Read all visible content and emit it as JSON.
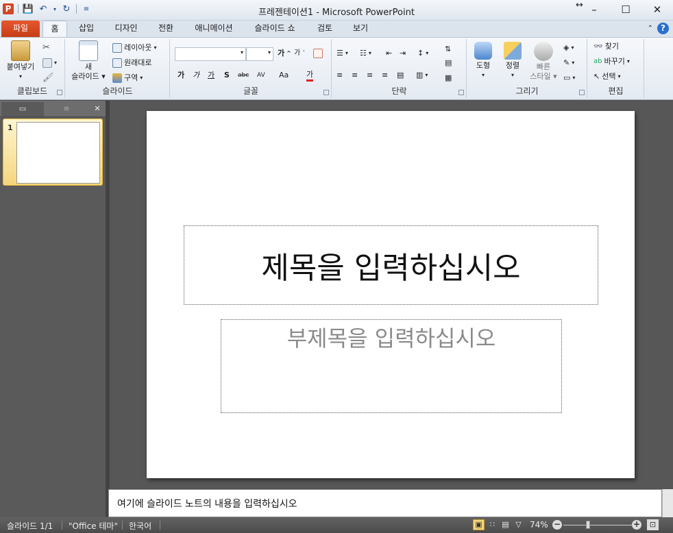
{
  "window": {
    "title": "프레젠테이션1  -  Microsoft PowerPoint",
    "app_icon": "P",
    "controls": [
      "–",
      "☐",
      "✕"
    ]
  },
  "tabs": {
    "file": "파일",
    "items": [
      "홈",
      "삽입",
      "디자인",
      "전환",
      "애니메이션",
      "슬라이드 쇼",
      "검토",
      "보기"
    ]
  },
  "ribbon": {
    "clipboard": {
      "label": "클립보드",
      "paste": "붙여넣기"
    },
    "slides": {
      "label": "슬라이드",
      "new_slide": "새\n슬라이드",
      "new_slide_l1": "새",
      "new_slide_l2": "슬라이드",
      "layout": "레이아웃",
      "reset": "원래대로",
      "section": "구역"
    },
    "font": {
      "label": "글꼴",
      "grow": "가",
      "shrink": "가",
      "format_buttons": [
        "가",
        "가",
        "가",
        "S",
        "abc",
        "AV",
        "Aa",
        "가"
      ]
    },
    "paragraph": {
      "label": "단락"
    },
    "drawing": {
      "label": "그리기",
      "shapes": "도형",
      "arrange": "정렬",
      "quick_styles_l1": "빠른",
      "quick_styles_l2": "스타일"
    },
    "editing": {
      "label": "편집",
      "find": "찾기",
      "replace": "바꾸기",
      "select": "선택"
    }
  },
  "panel": {
    "slide_number": "1"
  },
  "slide": {
    "title_placeholder": "제목을 입력하십시오",
    "subtitle_placeholder": "부제목을 입력하십시오"
  },
  "notes": {
    "placeholder": "여기에 슬라이드 노트의 내용을 입력하십시오"
  },
  "status": {
    "slide_info": "슬라이드 1/1",
    "theme": "\"Office 테마\"",
    "language": "한국어",
    "zoom": "74%"
  },
  "colors": {
    "file_tab": "#d24726",
    "help": "#2a6fcf",
    "thumb_selected": "#f6d67d"
  }
}
